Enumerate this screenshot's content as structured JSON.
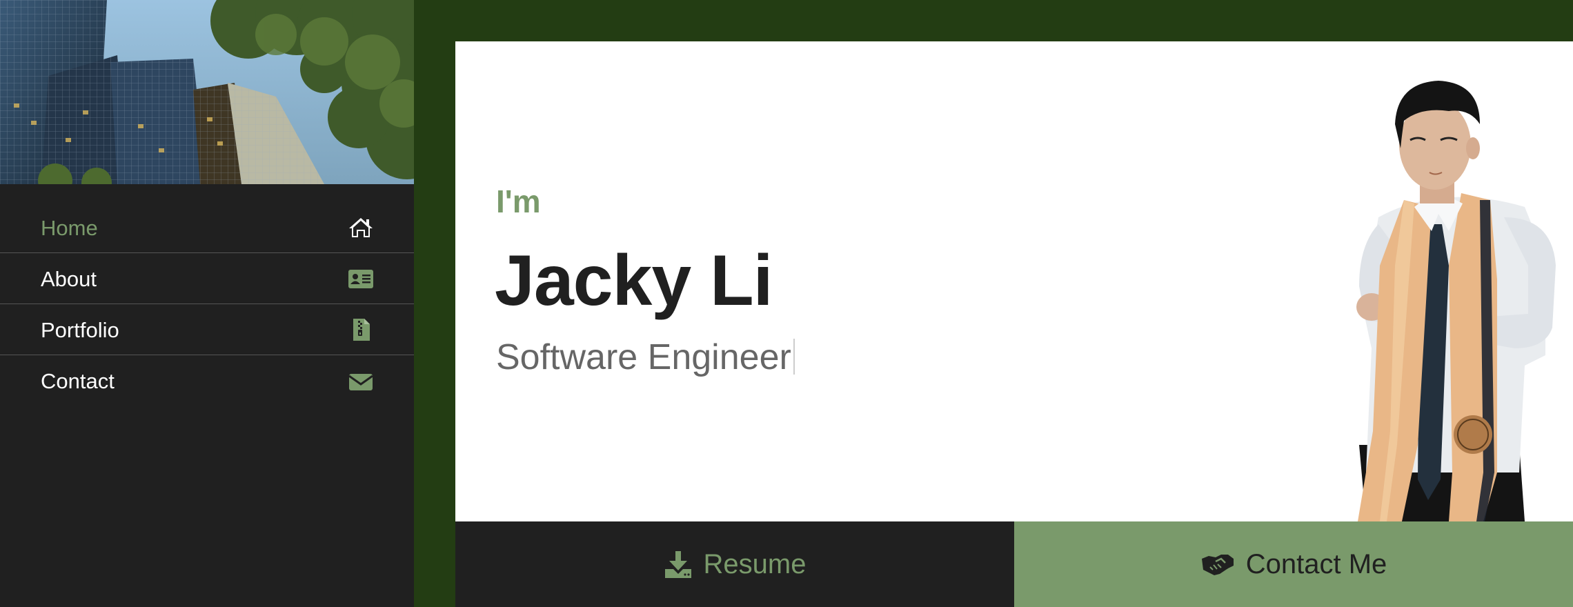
{
  "colors": {
    "accent": "#7a9a6b",
    "dark": "#202020",
    "frame": "#233d13",
    "muted": "#666666"
  },
  "sidebar": {
    "nav": [
      {
        "label": "Home",
        "icon": "home-icon",
        "active": true
      },
      {
        "label": "About",
        "icon": "id-card-icon",
        "active": false
      },
      {
        "label": "Portfolio",
        "icon": "file-archive-icon",
        "active": false
      },
      {
        "label": "Contact",
        "icon": "envelope-icon",
        "active": false
      }
    ]
  },
  "intro": {
    "pre": "I'm",
    "name": "Jacky Li",
    "role": "Software Engineer"
  },
  "actions": {
    "resume_label": "Resume",
    "resume_icon": "download-icon",
    "contact_label": "Contact Me",
    "contact_icon": "handshake-icon"
  }
}
